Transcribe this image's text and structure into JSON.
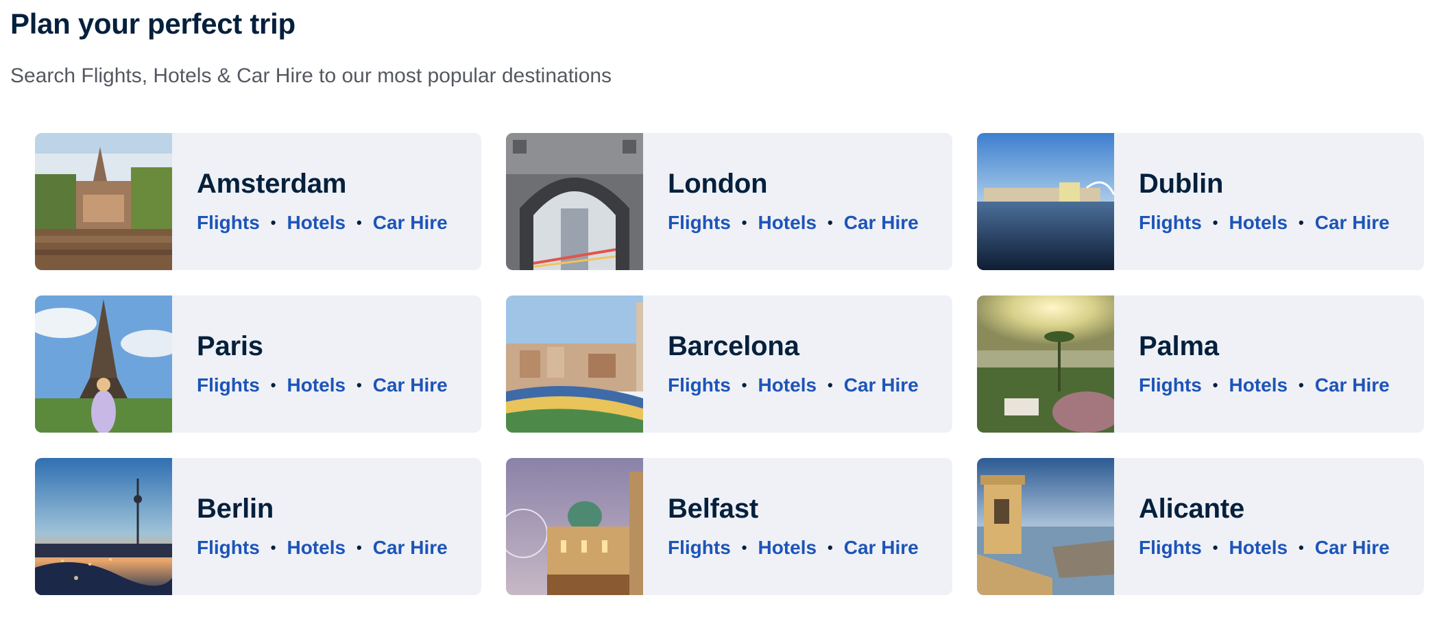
{
  "header": {
    "title": "Plan your perfect trip",
    "subtitle": "Search Flights, Hotels & Car Hire to our most popular destinations"
  },
  "destinations": [
    {
      "city": "Amsterdam",
      "flights": "Flights",
      "hotels": "Hotels",
      "car_hire": "Car Hire",
      "image": "amsterdam-canal-photo"
    },
    {
      "city": "London",
      "flights": "Flights",
      "hotels": "Hotels",
      "car_hire": "Car Hire",
      "image": "london-tower-bridge-photo"
    },
    {
      "city": "Dublin",
      "flights": "Flights",
      "hotels": "Hotels",
      "car_hire": "Car Hire",
      "image": "dublin-river-liffey-photo"
    },
    {
      "city": "Paris",
      "flights": "Flights",
      "hotels": "Hotels",
      "car_hire": "Car Hire",
      "image": "paris-eiffel-tower-photo"
    },
    {
      "city": "Barcelona",
      "flights": "Flights",
      "hotels": "Hotels",
      "car_hire": "Car Hire",
      "image": "barcelona-park-guell-photo"
    },
    {
      "city": "Palma",
      "flights": "Flights",
      "hotels": "Hotels",
      "car_hire": "Car Hire",
      "image": "palma-bay-sunset-photo"
    },
    {
      "city": "Berlin",
      "flights": "Flights",
      "hotels": "Hotels",
      "car_hire": "Car Hire",
      "image": "berlin-skyline-dusk-photo"
    },
    {
      "city": "Belfast",
      "flights": "Flights",
      "hotels": "Hotels",
      "car_hire": "Car Hire",
      "image": "belfast-city-hall-photo"
    },
    {
      "city": "Alicante",
      "flights": "Flights",
      "hotels": "Hotels",
      "car_hire": "Car Hire",
      "image": "alicante-castle-coast-photo"
    }
  ],
  "colors": {
    "heading": "#05203c",
    "link": "#1d54b8",
    "card_bg": "#eff1f6",
    "subtitle": "#545860"
  }
}
